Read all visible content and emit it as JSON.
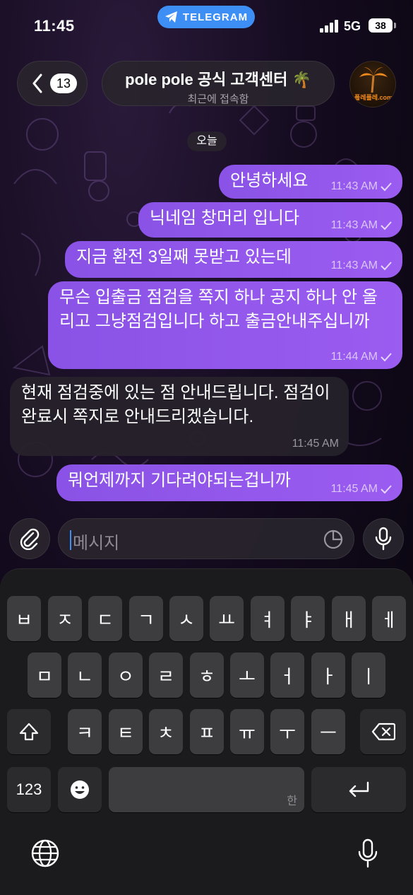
{
  "status_bar": {
    "time": "11:45",
    "app_pill": "TELEGRAM",
    "network": "5G",
    "battery": "38"
  },
  "header": {
    "back_badge": "13",
    "chat_name": "pole pole 공식 고객센터 🌴",
    "chat_status": "최근에 접속함",
    "avatar_text": "폴레폴레.com"
  },
  "chat": {
    "date_label": "오늘",
    "messages": [
      {
        "direction": "out",
        "text": "안녕하세요",
        "time": "11:43 AM"
      },
      {
        "direction": "out",
        "text": "닉네임 창머리 입니다",
        "time": "11:43 AM"
      },
      {
        "direction": "out",
        "text": "지금 환전 3일째 못받고 있는데",
        "time": "11:43 AM"
      },
      {
        "direction": "out",
        "text": "무슨 입출금 점검을 쪽지 하나 공지 하나 안 올리고  그냥점검입니다 하고 출금안내주십니까",
        "time": "11:44 AM"
      },
      {
        "direction": "in",
        "text": "현재 점검중에 있는 점 안내드립니다. 점검이 완료시 쪽지로 안내드리겠습니다.",
        "time": "11:45 AM"
      },
      {
        "direction": "out",
        "text": "뭐언제까지 기다려야되는겁니까",
        "time": "11:45 AM"
      }
    ]
  },
  "input": {
    "placeholder": "메시지"
  },
  "keyboard": {
    "row1": [
      "ㅂ",
      "ㅈ",
      "ㄷ",
      "ㄱ",
      "ㅅ",
      "ㅛ",
      "ㅕ",
      "ㅑ",
      "ㅐ",
      "ㅔ"
    ],
    "row2": [
      "ㅁ",
      "ㄴ",
      "ㅇ",
      "ㄹ",
      "ㅎ",
      "ㅗ",
      "ㅓ",
      "ㅏ",
      "ㅣ"
    ],
    "row3": [
      "ㅋ",
      "ㅌ",
      "ㅊ",
      "ㅍ",
      "ㅠ",
      "ㅜ",
      "ㅡ"
    ],
    "numbers_label": "123",
    "space_hint": "한"
  },
  "colors": {
    "outgoing_bubble": "#9157eb",
    "incoming_bubble": "#26222a",
    "accent": "#3d8ff5"
  }
}
